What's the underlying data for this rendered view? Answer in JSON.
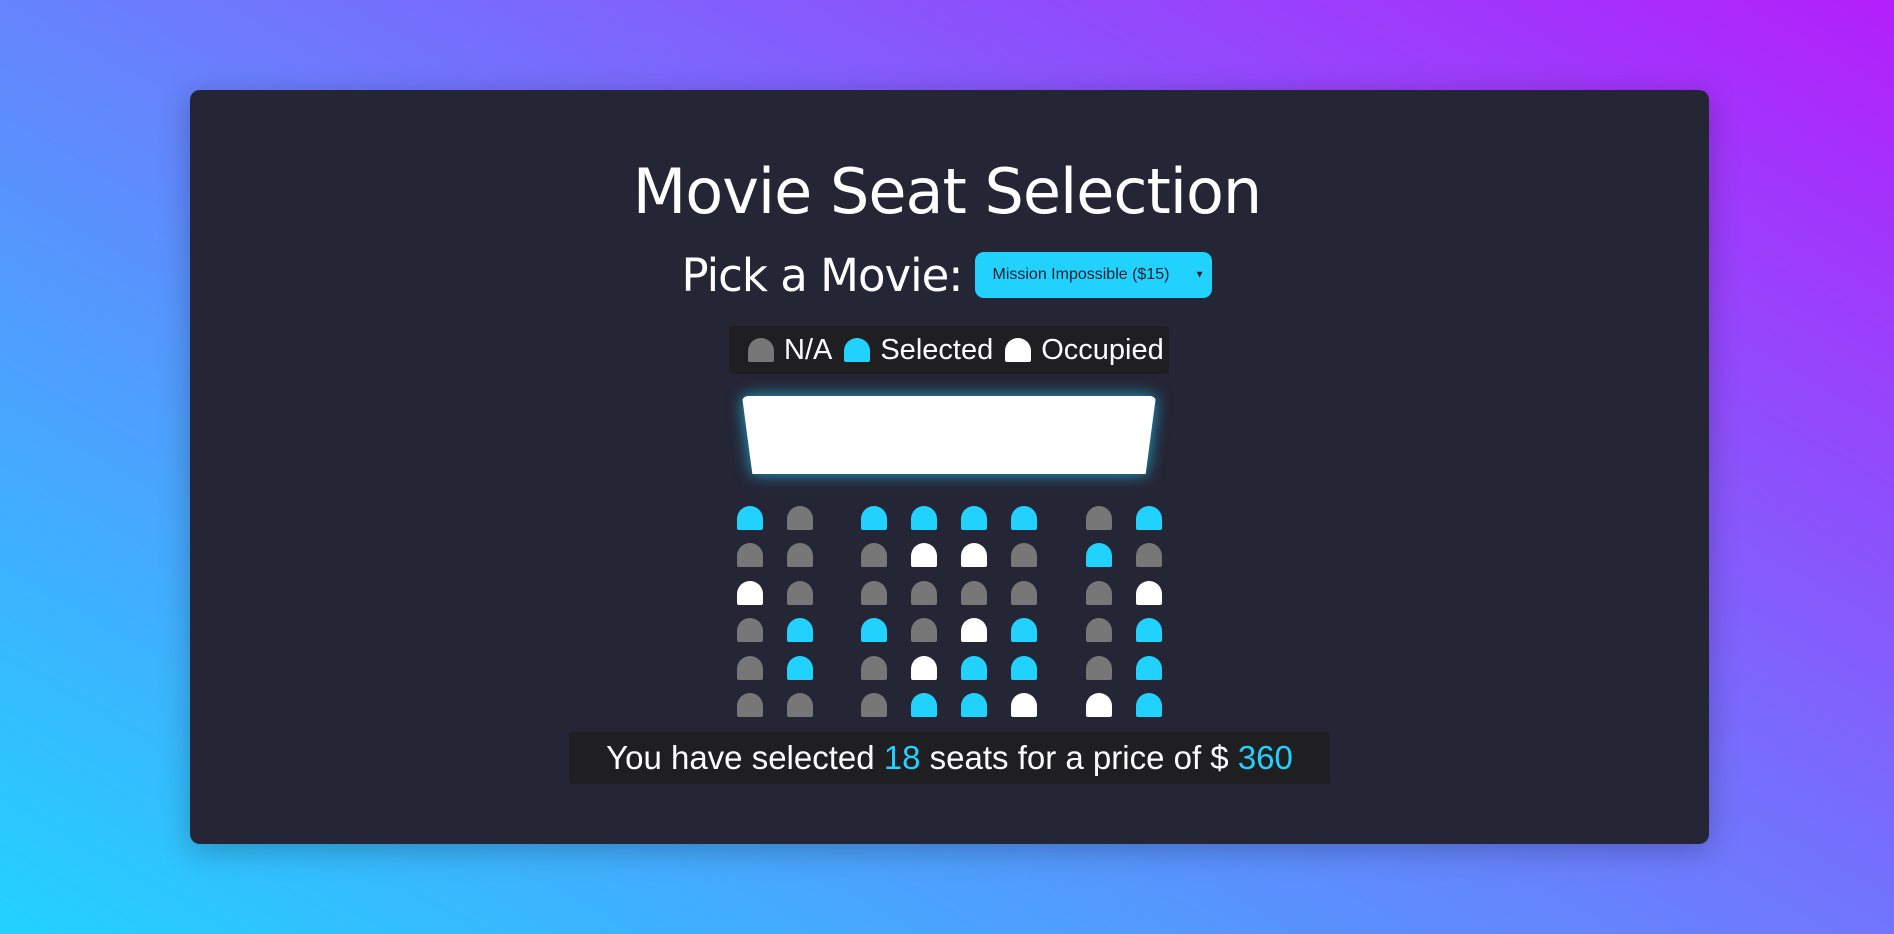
{
  "title": "Movie Seat Selection",
  "picker": {
    "label": "Pick a Movie:",
    "selected_movie": "Mission Impossible ($15)",
    "arrow_icon": "triangle-down-icon"
  },
  "legend": {
    "na_label": "N/A",
    "selected_label": "Selected",
    "occupied_label": "Occupied"
  },
  "colors": {
    "accent": "#22d2fe",
    "na": "#777777",
    "occupied": "#ffffff",
    "card": "#242535"
  },
  "seats": [
    [
      "selected",
      "na",
      "selected",
      "selected",
      "selected",
      "selected",
      "na",
      "selected"
    ],
    [
      "na",
      "na",
      "na",
      "occupied",
      "occupied",
      "na",
      "selected",
      "na"
    ],
    [
      "occupied",
      "na",
      "na",
      "na",
      "na",
      "na",
      "na",
      "occupied"
    ],
    [
      "na",
      "selected",
      "selected",
      "na",
      "occupied",
      "selected",
      "na",
      "selected"
    ],
    [
      "na",
      "selected",
      "na",
      "occupied",
      "selected",
      "selected",
      "na",
      "selected"
    ],
    [
      "na",
      "na",
      "na",
      "selected",
      "selected",
      "occupied",
      "occupied",
      "selected"
    ]
  ],
  "summary": {
    "prefix": "You have selected ",
    "count": "18",
    "middle": " seats for a price of $ ",
    "price": "360"
  }
}
